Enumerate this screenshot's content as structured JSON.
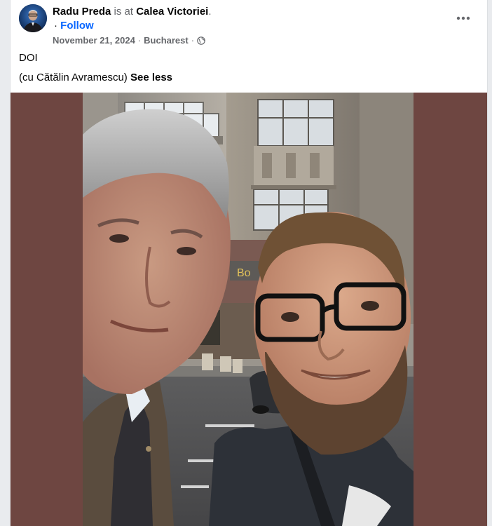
{
  "post": {
    "author": "Radu Preda",
    "at_text": " is at ",
    "place": "Calea Victoriei",
    "place_suffix": ".",
    "follow_dot": "·",
    "follow_label": "Follow",
    "date": "November 21, 2024",
    "separator": "·",
    "location": "Bucharest",
    "separator2": "·",
    "privacy_icon": "globe-icon",
    "more_icon": "more-horizontal-icon",
    "text_line1": "DOI",
    "text_line2": "(cu Cătălin Avramescu)",
    "see_less": "See less"
  },
  "colors": {
    "link_blue": "#0866ff",
    "photo_background": "#6e4641",
    "secondary_text": "#65676b"
  }
}
